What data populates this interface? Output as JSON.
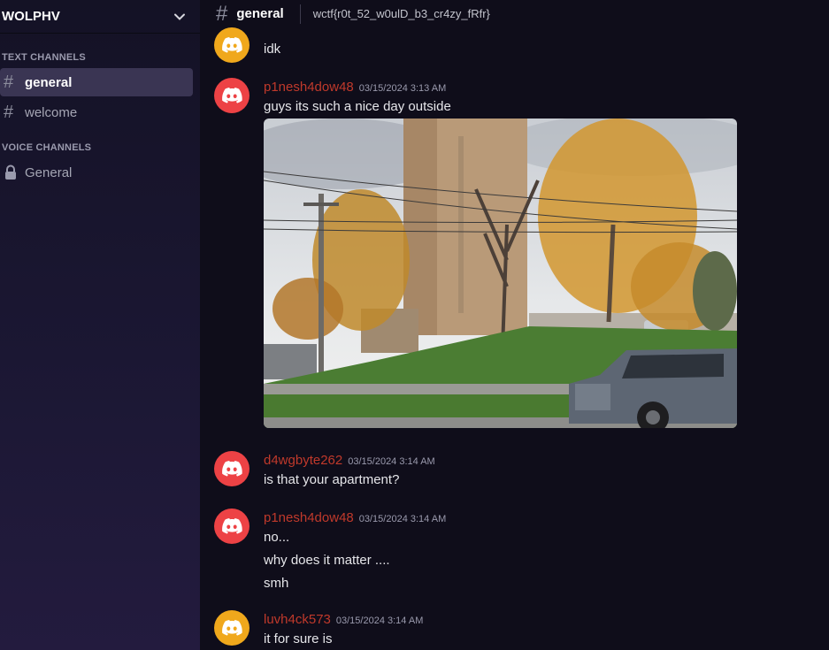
{
  "server": {
    "name": "WOLPHV"
  },
  "sidebar": {
    "text_category": "TEXT CHANNELS",
    "text_channels": [
      {
        "label": "general",
        "active": true
      },
      {
        "label": "welcome",
        "active": false
      }
    ],
    "voice_category": "VOICE CHANNELS",
    "voice_channels": [
      {
        "label": "General",
        "locked": true
      }
    ]
  },
  "header": {
    "channel": "general",
    "topic": "wctf{r0t_52_w0ulD_b3_cr4zy_fRfr}"
  },
  "messages": [
    {
      "author": "",
      "timestamp": "",
      "avatar": "yellow",
      "lines": [
        "idk"
      ]
    },
    {
      "author": "p1nesh4dow48",
      "timestamp": "03/15/2024 3:13 AM",
      "avatar": "red",
      "lines": [
        "guys its such a nice day outside"
      ],
      "attachment": "street-view-photo"
    },
    {
      "author": "d4wgbyte262",
      "timestamp": "03/15/2024 3:14 AM",
      "avatar": "red",
      "lines": [
        "is that your apartment?"
      ]
    },
    {
      "author": "p1nesh4dow48",
      "timestamp": "03/15/2024 3:14 AM",
      "avatar": "red",
      "lines": [
        "no...",
        "why does it matter ....",
        "smh"
      ]
    },
    {
      "author": "luvh4ck573",
      "timestamp": "03/15/2024 3:14 AM",
      "avatar": "yellow",
      "lines": [
        "it for sure is"
      ]
    }
  ],
  "colors": {
    "accent_red": "#ed4245",
    "accent_yellow": "#f0a81c",
    "username_red": "#c0392b",
    "active_channel_bg": "#3a3553"
  }
}
